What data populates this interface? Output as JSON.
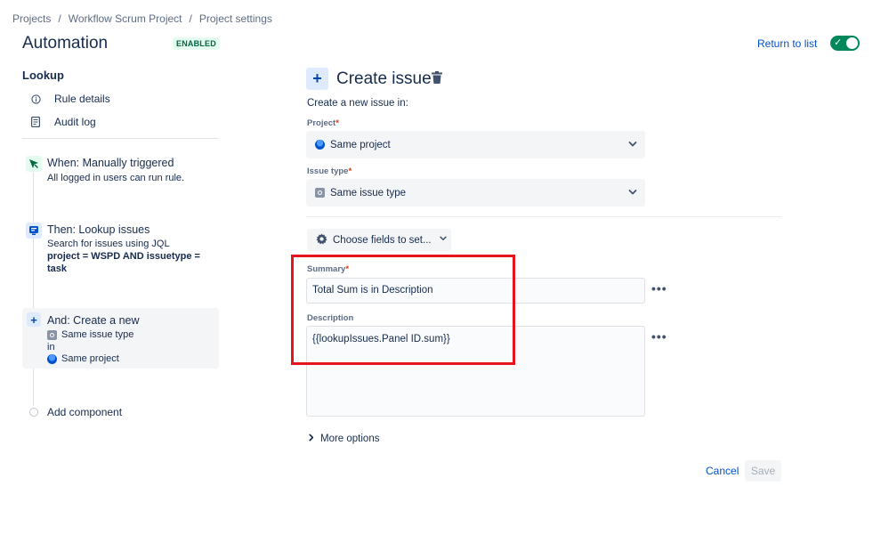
{
  "breadcrumb": [
    "Projects",
    "Workflow Scrum Project",
    "Project settings"
  ],
  "breadcrumb_separator": "/",
  "page_title": "Automation",
  "status_badge": "ENABLED",
  "return_link": "Return to list",
  "toggle_state": "on",
  "sidebar": {
    "heading": "Lookup",
    "links": [
      {
        "label": "Rule details",
        "icon": "info-icon"
      },
      {
        "label": "Audit log",
        "icon": "audit-log-icon"
      }
    ],
    "steps": [
      {
        "title": "When: Manually triggered",
        "sub": "All logged in users can run rule.",
        "icon": "manual-trigger-icon"
      },
      {
        "title": "Then: Lookup issues",
        "sub": "Search for issues using JQL",
        "sub_bold": "project = WSPD AND issuetype =",
        "sub_bold2": "task",
        "icon": "lookup-issues-icon"
      },
      {
        "title": "And: Create a new",
        "line1": "Same issue type",
        "line2": "in",
        "line3": "Same project",
        "icon": "plus-icon"
      }
    ],
    "add_component": "Add component"
  },
  "main": {
    "title": "Create issue",
    "subtitle": "Create a new issue in:",
    "project_label": "Project",
    "project_value": "Same project",
    "issue_type_label": "Issue type",
    "issue_type_value": "Same issue type",
    "required_marker": "*",
    "choose_fields": "Choose fields to set...",
    "summary_label": "Summary",
    "summary_value": "Total Sum is in Description",
    "description_label": "Description",
    "description_value": "{{lookupIssues.Panel ID.sum}}",
    "more_options": "More options",
    "cancel": "Cancel",
    "save": "Save",
    "dots": "•••"
  },
  "colors": {
    "accent": "#0052cc",
    "enabled_badge": "#006644",
    "toggle_on": "#00875a",
    "highlight_box": "#e8141c"
  }
}
